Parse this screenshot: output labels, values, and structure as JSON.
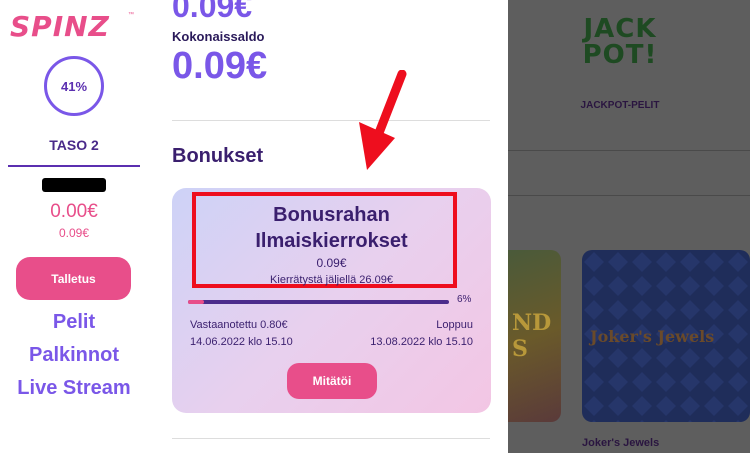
{
  "sidebar": {
    "logo": "SPINZ",
    "logo_tm": "™",
    "level_progress": "41%",
    "level_label": "TASO 2",
    "balance_main": "0.00€",
    "balance_sub": "0.09€",
    "deposit_label": "Talletus",
    "nav": [
      "Pelit",
      "Palkinnot",
      "Live Stream"
    ]
  },
  "drawer": {
    "prev_balance": "0.09€",
    "total_label": "Kokonaissaldo",
    "total_value": "0.09€",
    "bonuses_title": "Bonukset",
    "bonus": {
      "title_line1": "Bonusrahan",
      "title_line2": "Ilmaiskierrokset",
      "amount": "0.09€",
      "wager_left": "Kierrätystä jäljellä  26.09€",
      "progress_pct": "6%",
      "progress_fraction": 0.06,
      "received_label": "Vastaanotettu 0.80€",
      "received_date": "14.06.2022 klo 15.10",
      "ends_label": "Loppuu",
      "ends_date": "13.08.2022 klo 15.10",
      "cancel_label": "Mitätöi"
    }
  },
  "background": {
    "jackpot_logo_line1": "JACK",
    "jackpot_logo_line2": "POT!",
    "jackpot_label": "JACKPOT-PELIT",
    "tile_left_text_line1": "ND",
    "tile_left_text_line2": "S",
    "tile_right_text": "Joker's Jewels",
    "tile_right_label": "Joker's Jewels"
  },
  "colors": {
    "brand_pink": "#e84e8a",
    "brand_purple": "#7a57e8",
    "annotation_red": "#ee0e1e"
  }
}
